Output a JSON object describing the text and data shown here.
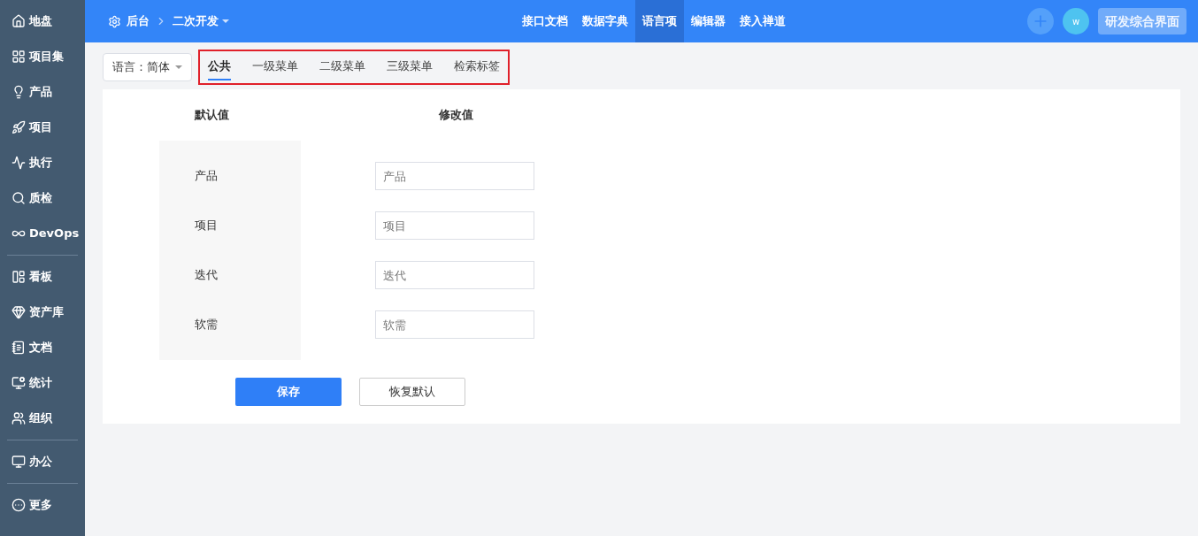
{
  "sidebar": {
    "groups": [
      [
        {
          "label": "地盘"
        },
        {
          "label": "项目集"
        },
        {
          "label": "产品"
        },
        {
          "label": "项目"
        },
        {
          "label": "执行"
        },
        {
          "label": "质检"
        },
        {
          "label": "DevOps"
        }
      ],
      [
        {
          "label": "看板"
        },
        {
          "label": "资产库"
        },
        {
          "label": "文档"
        },
        {
          "label": "统计"
        },
        {
          "label": "组织"
        }
      ],
      [
        {
          "label": "办公"
        }
      ],
      [
        {
          "label": "更多"
        }
      ]
    ]
  },
  "topbar": {
    "breadcrumb": [
      "后台",
      "二次开发"
    ],
    "nav": [
      {
        "label": "接口文档",
        "selected": false
      },
      {
        "label": "数据字典",
        "selected": false
      },
      {
        "label": "语言项",
        "selected": true
      },
      {
        "label": "编辑器",
        "selected": false
      },
      {
        "label": "接入禅道",
        "selected": false
      }
    ],
    "avatar": "w",
    "app_button": "研发综合界面"
  },
  "language_select": "语言：简体",
  "tabs": [
    {
      "label": "公共",
      "selected": true
    },
    {
      "label": "一级菜单",
      "selected": false
    },
    {
      "label": "二级菜单",
      "selected": false
    },
    {
      "label": "三级菜单",
      "selected": false
    },
    {
      "label": "检索标签",
      "selected": false
    }
  ],
  "table": {
    "columns": [
      "默认值",
      "修改值"
    ],
    "rows": [
      {
        "default": "产品",
        "placeholder": "产品"
      },
      {
        "default": "项目",
        "placeholder": "项目"
      },
      {
        "default": "迭代",
        "placeholder": "迭代"
      },
      {
        "default": "软需",
        "placeholder": "软需"
      }
    ]
  },
  "buttons": {
    "save": "保存",
    "reset": "恢复默认"
  }
}
